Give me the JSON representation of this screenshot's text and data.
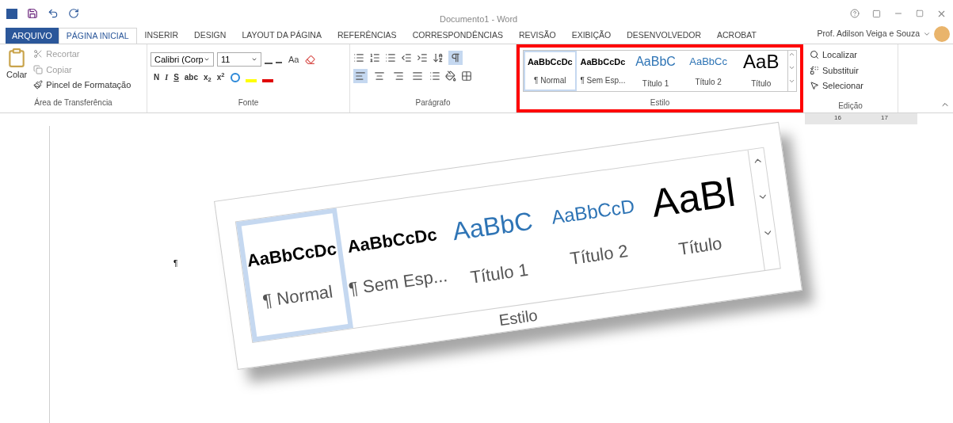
{
  "window": {
    "title": "Documento1 - Word",
    "user": "Prof. Adilson Veiga e Souza"
  },
  "tabs": [
    {
      "label": "ARQUIVO",
      "kind": "file",
      "selected": false
    },
    {
      "label": "PÁGINA INICIAL",
      "kind": "tab",
      "selected": true
    },
    {
      "label": "INSERIR",
      "kind": "tab",
      "selected": false
    },
    {
      "label": "DESIGN",
      "kind": "tab",
      "selected": false
    },
    {
      "label": "LAYOUT DA PÁGINA",
      "kind": "tab",
      "selected": false
    },
    {
      "label": "REFERÊNCIAS",
      "kind": "tab",
      "selected": false
    },
    {
      "label": "CORRESPONDÊNCIAS",
      "kind": "tab",
      "selected": false
    },
    {
      "label": "REVISÃO",
      "kind": "tab",
      "selected": false
    },
    {
      "label": "EXIBIÇÃO",
      "kind": "tab",
      "selected": false
    },
    {
      "label": "DESENVOLVEDOR",
      "kind": "tab",
      "selected": false
    },
    {
      "label": "ACROBAT",
      "kind": "tab",
      "selected": false
    }
  ],
  "clipboard": {
    "label": "Área de Transferência",
    "paste": "Colar",
    "items": [
      {
        "label": "Recortar",
        "disabled": true
      },
      {
        "label": "Copiar",
        "disabled": true
      },
      {
        "label": "Pincel de Formatação",
        "disabled": false
      }
    ]
  },
  "font": {
    "label": "Fonte",
    "font_name": "Calibri (Corp",
    "font_size": "11",
    "case_button": "Aa",
    "format_buttons": [
      "N",
      "I",
      "S",
      "abc",
      "x$_{2}$",
      "x$^{2}$"
    ]
  },
  "paragraph": {
    "label": "Parágrafo",
    "show_marks": true,
    "alignment_selected": [
      true,
      false,
      false,
      false
    ]
  },
  "styles": {
    "label": "Estilo",
    "highlighted": true,
    "items": [
      {
        "sample": "AaBbCcDc",
        "name": "¶ Normal",
        "kind": "body",
        "selected": true
      },
      {
        "sample": "AaBbCcDc",
        "name": "¶ Sem Esp...",
        "kind": "body",
        "selected": false
      },
      {
        "sample": "AaBbC",
        "name": "Título 1",
        "kind": "heading1",
        "selected": false
      },
      {
        "sample": "AaBbCc",
        "name": "Título 2",
        "kind": "heading2",
        "selected": false
      },
      {
        "sample": "AaB",
        "name": "Título",
        "kind": "title",
        "selected": false
      }
    ]
  },
  "editing": {
    "label": "Edição",
    "items": [
      "Localizar",
      "Substituir",
      "Selecionar"
    ]
  },
  "ruler": {
    "marks": [
      "16",
      "17"
    ]
  },
  "document": {
    "paragraph_mark": "¶"
  },
  "callout": {
    "label": "Estilo",
    "items": [
      {
        "sample": "AaBbCcDc",
        "name": "¶ Normal",
        "kind": "body",
        "selected": true
      },
      {
        "sample": "AaBbCcDc",
        "name": "¶ Sem Esp...",
        "kind": "body",
        "selected": false
      },
      {
        "sample": "AaBbC",
        "name": "Título 1",
        "kind": "heading1",
        "selected": false
      },
      {
        "sample": "AaBbCcD",
        "name": "Título 2",
        "kind": "heading2",
        "selected": false
      },
      {
        "sample": "AaBl",
        "name": "Título",
        "kind": "title",
        "selected": false
      }
    ]
  }
}
